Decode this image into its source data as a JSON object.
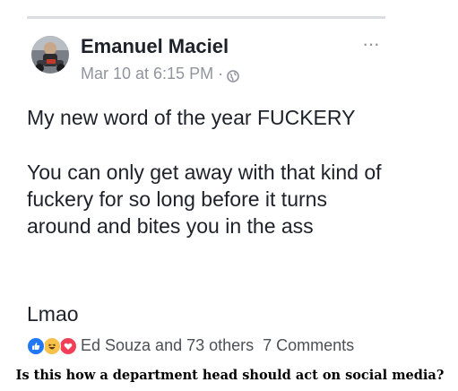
{
  "post": {
    "author": "Emanuel Maciel",
    "timestamp": "Mar 10 at 6:15 PM",
    "separator": "·",
    "privacy_icon": "globe-icon",
    "more_icon": "more-options-icon",
    "more_glyph": "···",
    "paragraphs": [
      "My new word of the year FUCKERY",
      "You can only get away with that kind of fuckery for so long before it turns around and bites you in the ass",
      "Lmao"
    ]
  },
  "reactions": {
    "icons": [
      "like-icon",
      "haha-icon",
      "love-icon"
    ],
    "summary": "Ed Souza and 73 others",
    "comments": "7 Comments"
  },
  "caption": "Is this how a department head should act on social media?",
  "colors": {
    "primary_text": "#1d2129",
    "secondary_text": "#90949c",
    "like_blue": "#2078f4",
    "haha_yellow": "#f7c14b",
    "love_red": "#f33e58"
  }
}
